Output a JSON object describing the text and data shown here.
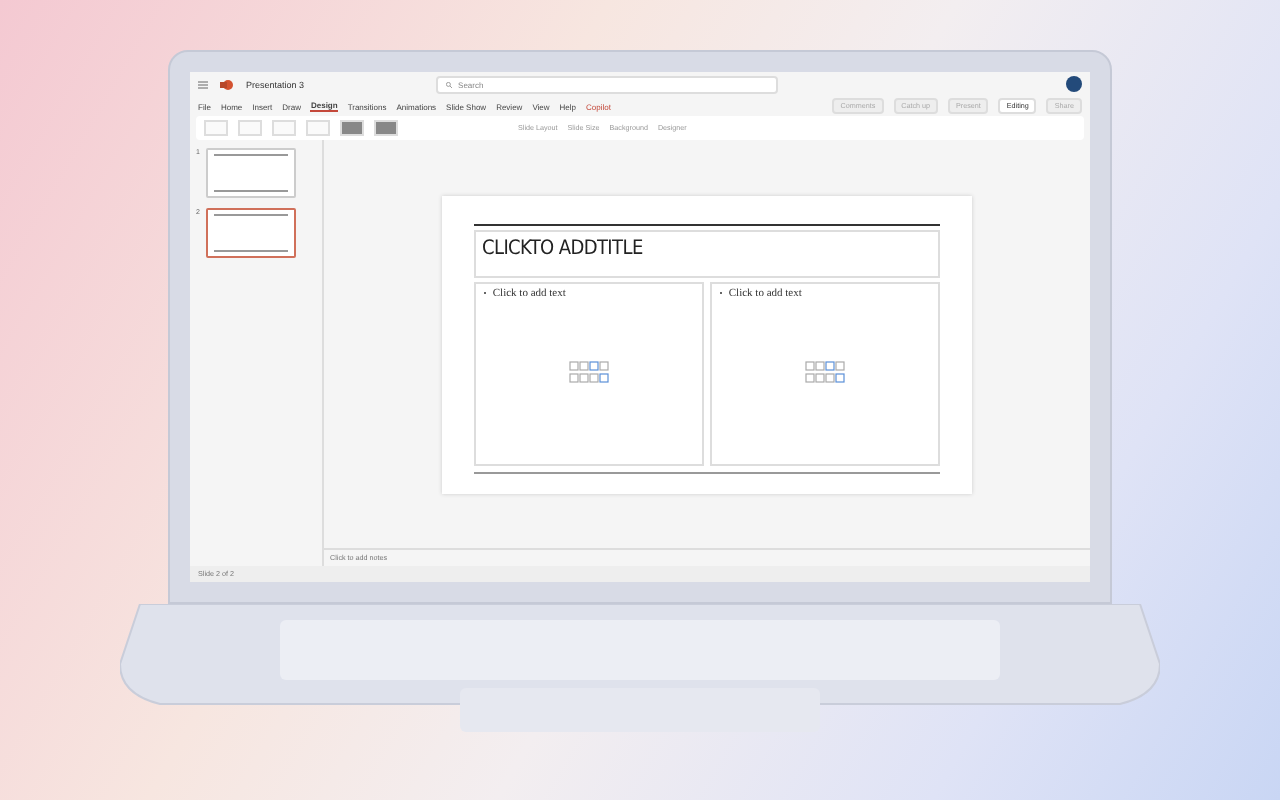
{
  "window": {
    "title": "Presentation 3"
  },
  "search": {
    "placeholder": "Search"
  },
  "tabs": [
    {
      "label": "File",
      "selected": false
    },
    {
      "label": "Home",
      "selected": false
    },
    {
      "label": "Insert",
      "selected": false
    },
    {
      "label": "Draw",
      "selected": false
    },
    {
      "label": "Design",
      "selected": true
    },
    {
      "label": "Transitions",
      "selected": false
    },
    {
      "label": "Animations",
      "selected": false
    },
    {
      "label": "Slide Show",
      "selected": false
    },
    {
      "label": "Review",
      "selected": false
    },
    {
      "label": "View",
      "selected": false
    },
    {
      "label": "Help",
      "selected": false
    },
    {
      "label": "Copilot",
      "selected": false,
      "kind": "accent"
    }
  ],
  "actions": [
    {
      "label": "Comments",
      "kind": "plain"
    },
    {
      "label": "Catch up",
      "kind": "plain"
    },
    {
      "label": "Present",
      "kind": "plain"
    },
    {
      "label": "Editing",
      "kind": "mode"
    },
    {
      "label": "Share",
      "kind": "plain"
    }
  ],
  "ribbon": {
    "commands": [
      "Slide Layout",
      "Slide Size",
      "Background",
      "Designer"
    ]
  },
  "slides": [
    {
      "number": "1",
      "selected": false
    },
    {
      "number": "2",
      "selected": true
    }
  ],
  "slide": {
    "title": "CLICKTO ADDTITLE",
    "placeholders": [
      "Click to add text",
      "Click to add text"
    ]
  },
  "notes": {
    "placeholder": "Click to add notes"
  },
  "status_bar": {
    "slide_count": "Slide 2 of 2"
  }
}
